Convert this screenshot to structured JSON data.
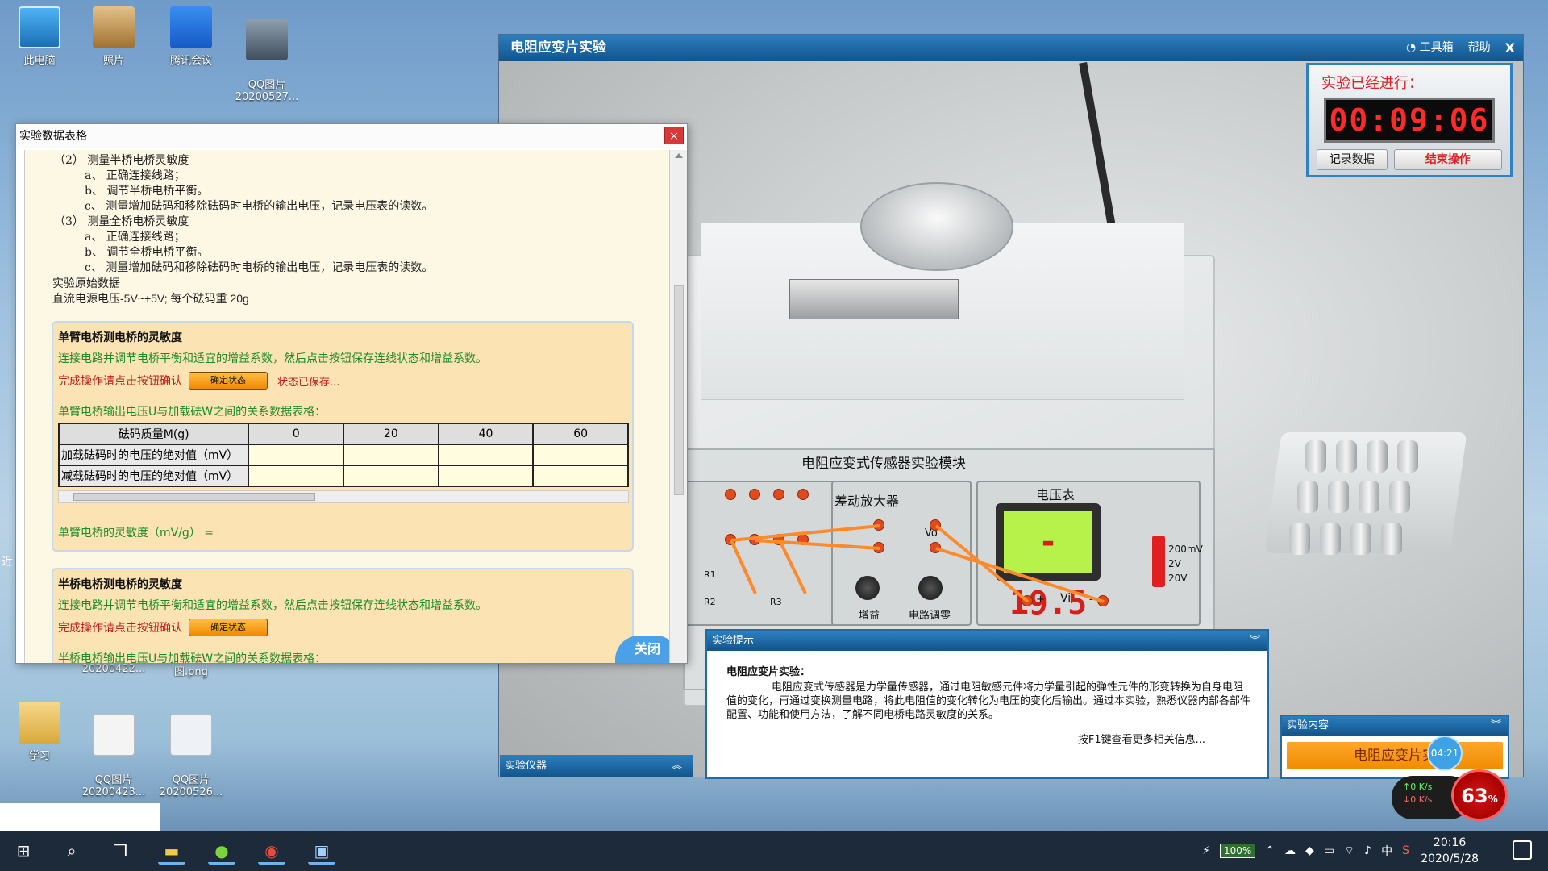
{
  "desktop": {
    "icons": [
      {
        "label": "此电脑",
        "icon": "computer-icon"
      },
      {
        "label": "照片",
        "icon": "photos-icon"
      },
      {
        "label": "腾讯会议",
        "icon": "tencent-meeting-icon"
      },
      {
        "label": "QQ图片\n20200527...",
        "icon": "image-file-icon"
      },
      {
        "label": "学习",
        "icon": "folder-icon"
      },
      {
        "label": "QQ图片\n20200423...",
        "icon": "image-file-icon"
      },
      {
        "label": "QQ图片\n20200526...",
        "icon": "image-file-icon"
      },
      {
        "label": "20200422...",
        "icon": "image-file-icon"
      },
      {
        "label": "图.png",
        "icon": "image-file-icon"
      }
    ],
    "side_char": "近"
  },
  "data_window": {
    "title": "实验数据表格",
    "close_label": "×",
    "instructions": [
      "（2） 测量半桥电桥灵敏度",
      "a、 正确连接线路；",
      "b、 调节半桥电桥平衡。",
      "c、 测量增加砝码和移除砝码时电桥的输出电压，记录电压表的读数。",
      "（3） 测量全桥电桥灵敏度",
      "a、 正确连接线路；",
      "b、 调节全桥电桥平衡。",
      "c、 测量增加砝码和移除砝码时电桥的输出电压，记录电压表的读数。",
      "实验原始数据",
      "直流电源电压-5V~+5V; 每个砝码重 20g"
    ],
    "section1": {
      "title": "单臂电桥测电桥的灵敏度",
      "instruction": "连接电路并调节电桥平衡和适宜的增益系数，然后点击按钮保存连线状态和增益系数。",
      "confirm_prompt": "完成操作请点击按钮确认",
      "confirm_button": "确定状态",
      "saved_status": "状态已保存...",
      "table_title": "单臂电桥输出电压U与加载砝W之间的关系数据表格：",
      "table": {
        "header_label": "砝码质量M(g)",
        "columns": [
          "0",
          "20",
          "40",
          "60"
        ],
        "rows": [
          {
            "label": "加载砝码时的电压的绝对值（mV）",
            "values": [
              "",
              "",
              "",
              ""
            ]
          },
          {
            "label": "减载砝码时的电压的绝对值（mV）",
            "values": [
              "",
              "",
              "",
              ""
            ]
          }
        ]
      },
      "sensitivity_label": "单臂电桥的灵敏度（mV/g） ="
    },
    "section2": {
      "title": "半桥电桥测电桥的灵敏度",
      "instruction": "连接电路并调节电桥平衡和适宜的增益系数，然后点击按钮保存连线状态和增益系数。",
      "confirm_prompt": "完成操作请点击按钮确认",
      "confirm_button": "确定状态",
      "table_title": "半桥电桥输出电压U与加载砝W之间的关系数据表格："
    },
    "close_badge": "关闭"
  },
  "sim_window": {
    "title": "电阻应变片实验",
    "toolbox": "工具箱",
    "help": "帮助",
    "close": "X",
    "module_title": "电阻应变式传感器实验模块",
    "amplifier_label": "差动放大器",
    "vo_label": "Vo",
    "gain_label": "增益",
    "zero_label": "电路调零",
    "voltmeter_label": "电压表",
    "voltmeter_reading": "- 19.5",
    "vi_label": "Vi",
    "plus_label": "+",
    "minus_label": "-",
    "ranges": [
      "200mV",
      "2V",
      "20V"
    ],
    "r1_label": "R1",
    "r2_label": "R2",
    "r3_label": "R3"
  },
  "timer": {
    "label": "实验已经进行：",
    "time": "00:09:06",
    "record_button": "记录数据",
    "end_button": "结束操作"
  },
  "hint": {
    "title": "实验提示",
    "heading": "电阻应变片实验：",
    "body": "电阻应变式传感器是力学量传感器，通过电阻敏感元件将力学量引起的弹性元件的形变转换为自身电阻值的变化，再通过变换测量电路，将此电阻值的变化转化为电压的变化后输出。通过本实验，熟悉仪器内部各部件配置、功能和使用方法，了解不同电桥电路灵敏度的关系。",
    "f1": "按F1键查看更多相关信息..."
  },
  "equipment_panel": {
    "title": "实验仪器"
  },
  "content_panel": {
    "title": "实验内容",
    "button": "电阻应变片实"
  },
  "overlay": {
    "mini_time": "04:21",
    "up_speed": "↑0  K/s",
    "down_speed": "↓0  K/s",
    "percent": "63",
    "percent_unit": "%"
  },
  "taskbar": {
    "battery": "100%",
    "ime": "中",
    "time": "20:16",
    "date": "2020/5/28"
  },
  "colors": {
    "title_bar_blue": "#13548b",
    "panel_orange": "#fbe3b3",
    "instruction_green": "#1d8a2a",
    "alert_red": "#c21b1b",
    "lcd_green": "#b7f24a"
  }
}
